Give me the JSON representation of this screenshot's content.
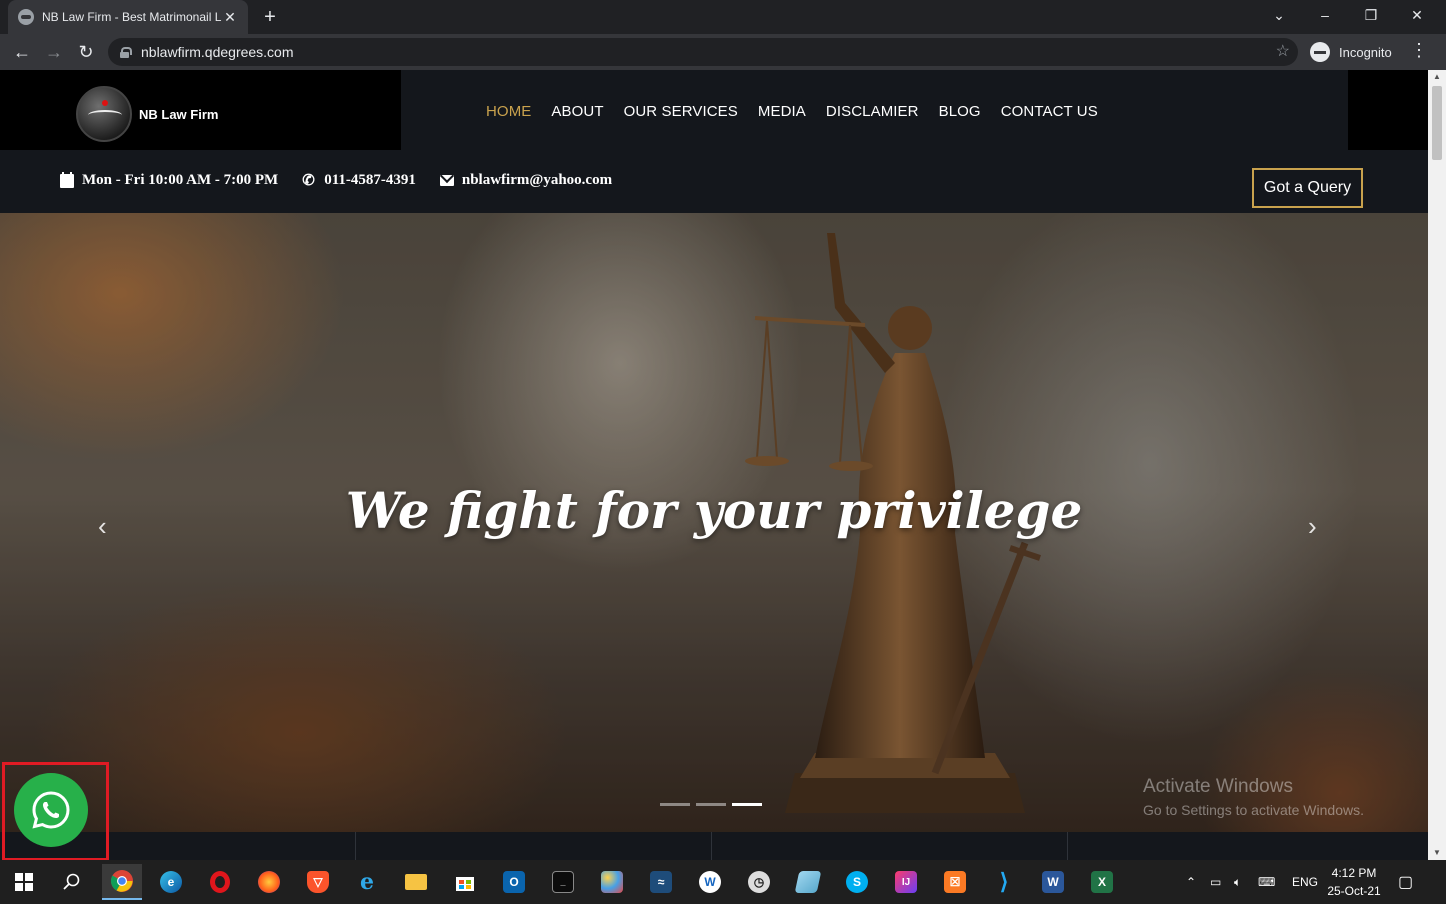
{
  "browser": {
    "tab_title": "NB Law Firm - Best Matrimonail L",
    "tab_close": "✕",
    "new_tab": "+",
    "url": "nblawfirm.qdegrees.com",
    "profile_label": "Incognito",
    "window_controls": {
      "minimize": "–",
      "restore": "❐",
      "close": "✕",
      "tab_search": "⌄"
    }
  },
  "site": {
    "logo_text": "NB Law Firm",
    "nav": [
      {
        "label": "HOME",
        "active": true
      },
      {
        "label": "ABOUT"
      },
      {
        "label": "OUR SERVICES"
      },
      {
        "label": "MEDIA"
      },
      {
        "label": "DISCLAMIER"
      },
      {
        "label": "BLOG"
      },
      {
        "label": "CONTACT US"
      }
    ],
    "info": {
      "hours": "Mon - Fri  10:00 AM - 7:00 PM",
      "phone": "011-4587-4391",
      "email": "nblawfirm@yahoo.com"
    },
    "query_button": "Got a Query",
    "hero": {
      "title": "We fight for your privilege",
      "prev": "‹",
      "next": "›",
      "slides": 3,
      "active_slide": 3
    },
    "watermark": {
      "line1": "Activate Windows",
      "line2": "Go to Settings to activate Windows."
    }
  },
  "colors": {
    "accent_gold": "#c9a24d",
    "whatsapp_green": "#27b04a",
    "highlight_red": "#e01b24"
  },
  "taskbar": {
    "apps": [
      "windows-start-icon",
      "search-icon",
      "chrome-icon",
      "edge-icon",
      "opera-icon",
      "firefox-icon",
      "brave-icon",
      "ie-icon",
      "file-explorer-icon",
      "store-icon",
      "outlook-icon",
      "terminal-icon",
      "paint-icon",
      "mysql-icon",
      "app-w-icon",
      "app-clock-icon",
      "notepad-icon",
      "skype-icon",
      "intellij-icon",
      "xampp-icon",
      "vscode-icon",
      "word-icon",
      "excel-icon"
    ],
    "language": "ENG",
    "time": "4:12 PM",
    "date": "25-Oct-21"
  }
}
